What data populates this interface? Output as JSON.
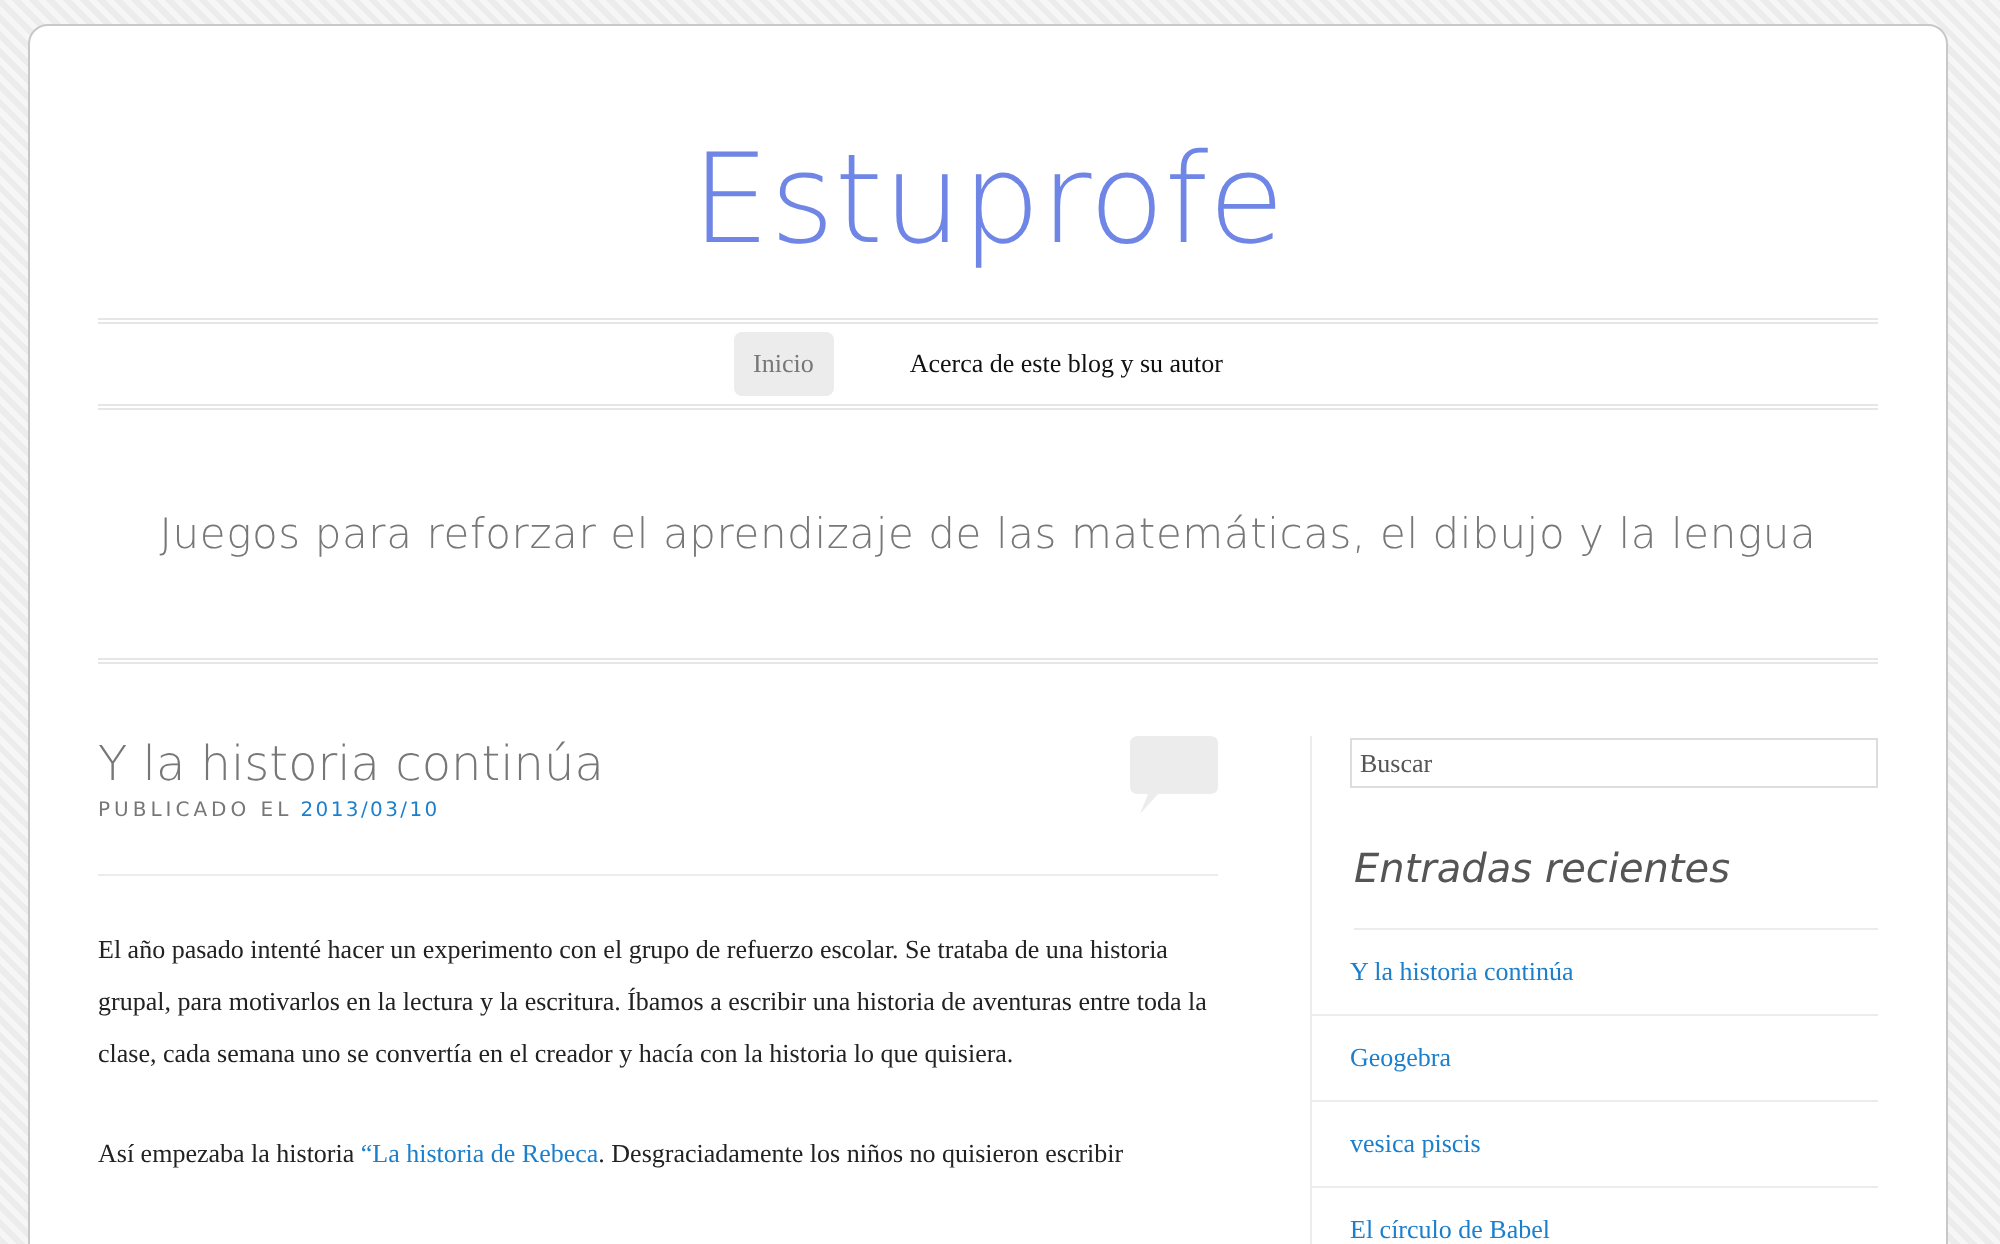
{
  "site": {
    "title": "Estuprofe",
    "tagline": "Juegos para reforzar el aprendizaje de las matemáticas, el dibujo y la lengua"
  },
  "nav": [
    {
      "label": "Inicio",
      "selected": true
    },
    {
      "label": "Acerca de este blog y su autor",
      "selected": false
    }
  ],
  "post": {
    "title": "Y la historia continúa",
    "meta_label": "PUBLICADO EL",
    "date": "2013/03/10",
    "paragraphs": [
      [
        {
          "kind": "text",
          "text": "El año pasado intenté hacer un experimento con el grupo de refuerzo escolar. Se trataba de una historia grupal, para motivarlos en la lectura y la escritura. Íbamos a escribir una historia de aventuras entre toda la clase, cada semana uno se convertía en el creador y hacía con la historia lo que quisiera."
        }
      ],
      [
        {
          "kind": "text",
          "text": "Así empezaba la historia "
        },
        {
          "kind": "link",
          "text": "“La historia de Rebeca"
        },
        {
          "kind": "text",
          "text": ". Desgraciadamente los niños no quisieron escribir"
        }
      ]
    ]
  },
  "sidebar": {
    "search": {
      "placeholder": "Buscar"
    },
    "heading": "Entradas recientes",
    "recent": [
      "Y la historia continúa",
      "Geogebra",
      "vesica piscis",
      "El círculo de Babel"
    ]
  }
}
